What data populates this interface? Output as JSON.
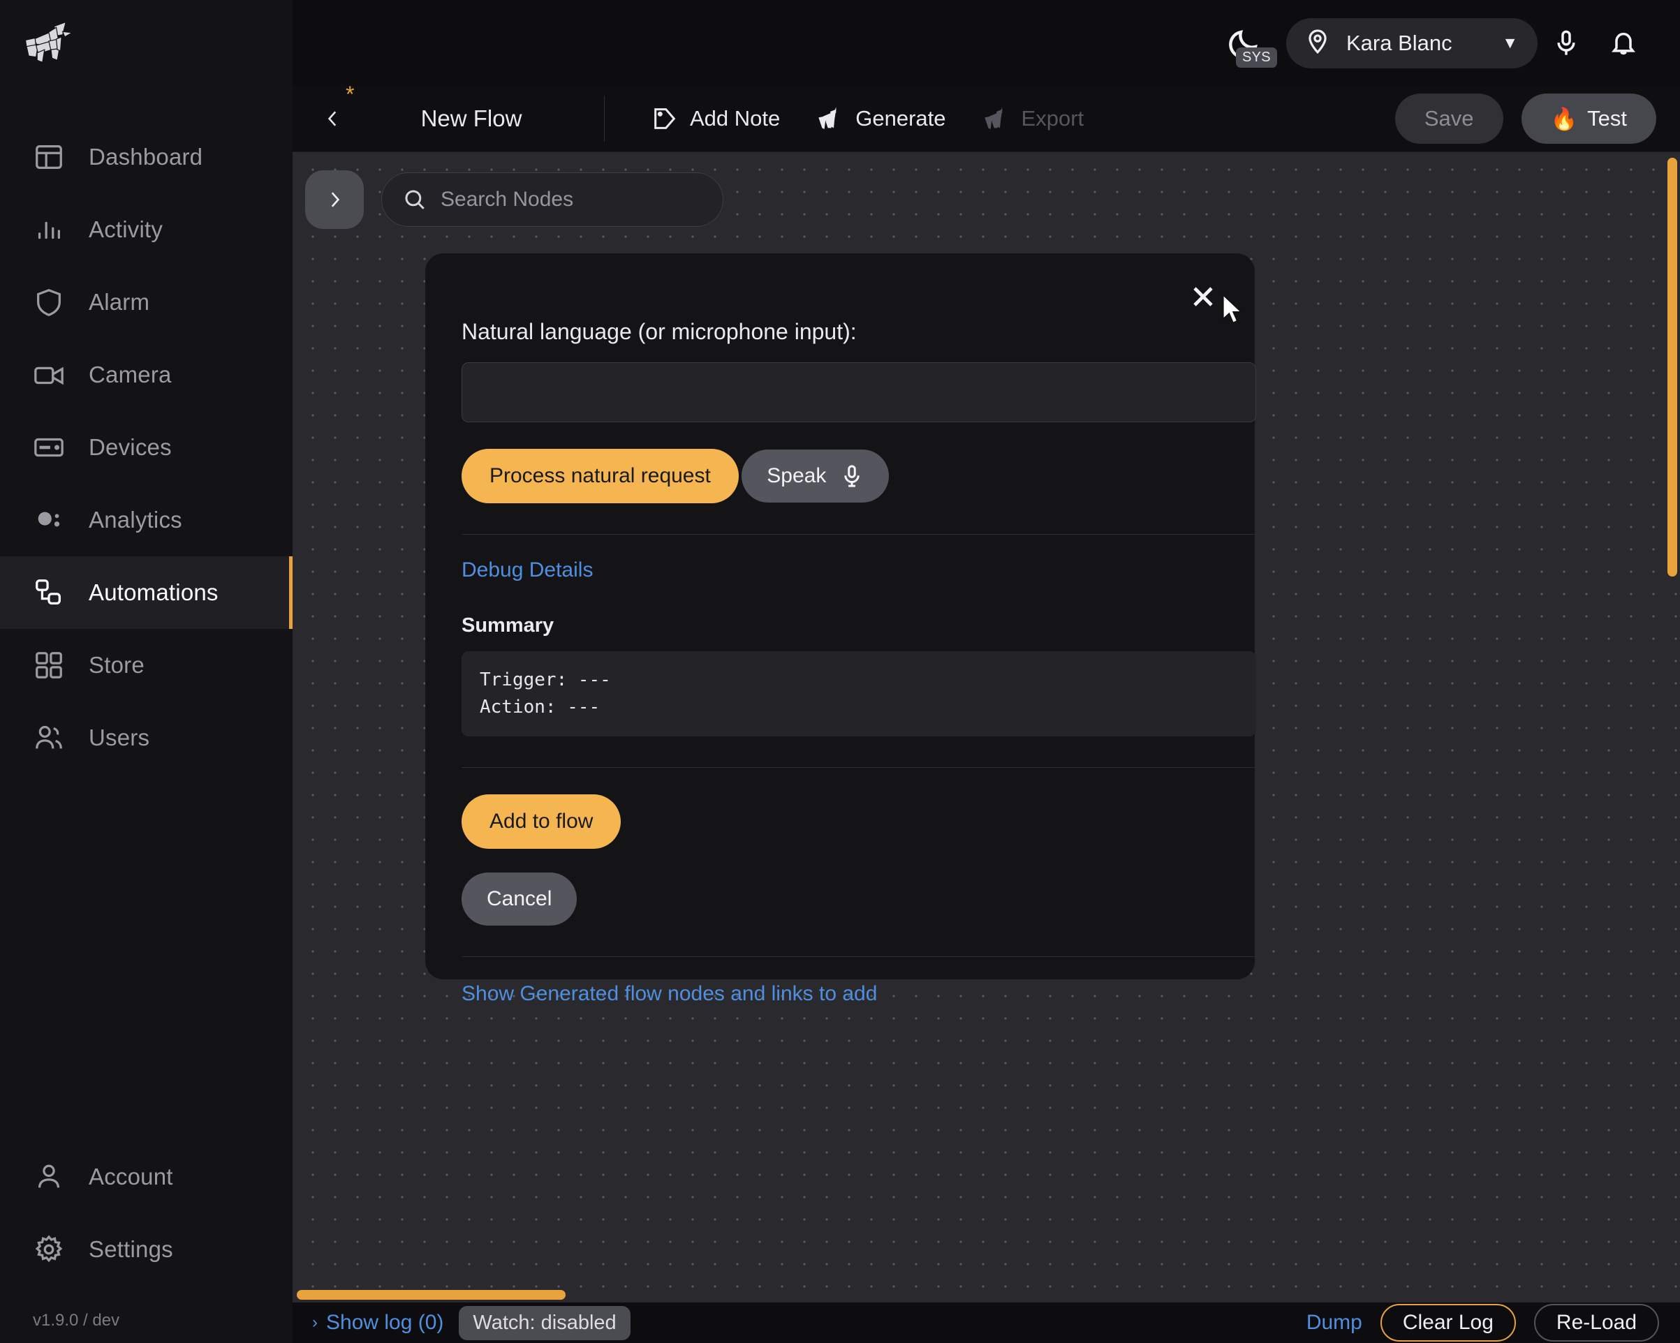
{
  "brand": {
    "logo_icon": "origami-unicorn-logo",
    "version": "v1.9.0 / dev"
  },
  "sidebar": {
    "top_items": [
      {
        "label": "Dashboard",
        "icon": "layout-dashboard-icon"
      },
      {
        "label": "Activity",
        "icon": "bar-chart-icon"
      },
      {
        "label": "Alarm",
        "icon": "shield-icon"
      },
      {
        "label": "Camera",
        "icon": "video-camera-icon"
      },
      {
        "label": "Devices",
        "icon": "device-card-icon"
      },
      {
        "label": "Analytics",
        "icon": "analytics-bubble-icon"
      },
      {
        "label": "Automations",
        "icon": "nodes-flow-icon",
        "active": true
      },
      {
        "label": "Store",
        "icon": "grid-squares-icon"
      },
      {
        "label": "Users",
        "icon": "users-icon"
      }
    ],
    "bottom_items": [
      {
        "label": "Account",
        "icon": "user-icon"
      },
      {
        "label": "Settings",
        "icon": "gear-icon"
      }
    ]
  },
  "header": {
    "theme_icon": "moon-icon",
    "theme_badge": "SYS",
    "location_icon": "map-pin-icon",
    "user_name": "Kara Blanc",
    "caret": "▼",
    "mic_icon": "microphone-icon",
    "bell_icon": "bell-icon"
  },
  "toolbar": {
    "back_icon": "chevron-left-icon",
    "dirty_marker": "*",
    "flow_title": "New Flow",
    "add_note_label": "Add Note",
    "add_note_icon": "tag-icon",
    "generate_label": "Generate",
    "generate_icon": "unicorn-icon",
    "export_label": "Export",
    "export_icon": "unicorn-icon",
    "save_label": "Save",
    "test_label": "Test",
    "test_icon": "🔥"
  },
  "canvas": {
    "expand_icon": "chevron-right-icon",
    "search_icon": "search-icon",
    "search_placeholder": "Search Nodes",
    "search_value": ""
  },
  "modal": {
    "close_icon": "close-icon",
    "prompt_label": "Natural language (or microphone input):",
    "prompt_value": "",
    "process_button": "Process natural request",
    "speak_button": "Speak",
    "speak_icon": "microphone-icon",
    "debug_link": "Debug Details",
    "summary_title": "Summary",
    "summary_code": "Trigger: ---\nAction: ---",
    "add_button": "Add to flow",
    "cancel_button": "Cancel",
    "show_nodes_link": "Show Generated flow nodes and links to add"
  },
  "bottombar": {
    "show_log_label": "Show log (0)",
    "show_log_chevron": "›",
    "watch_badge": "Watch: disabled",
    "dump_label": "Dump",
    "clear_log_label": "Clear Log",
    "reload_label": "Re-Load"
  },
  "colors": {
    "accent": "#e8a33d",
    "primary_button": "#f5b551",
    "link": "#4f8fe0"
  }
}
